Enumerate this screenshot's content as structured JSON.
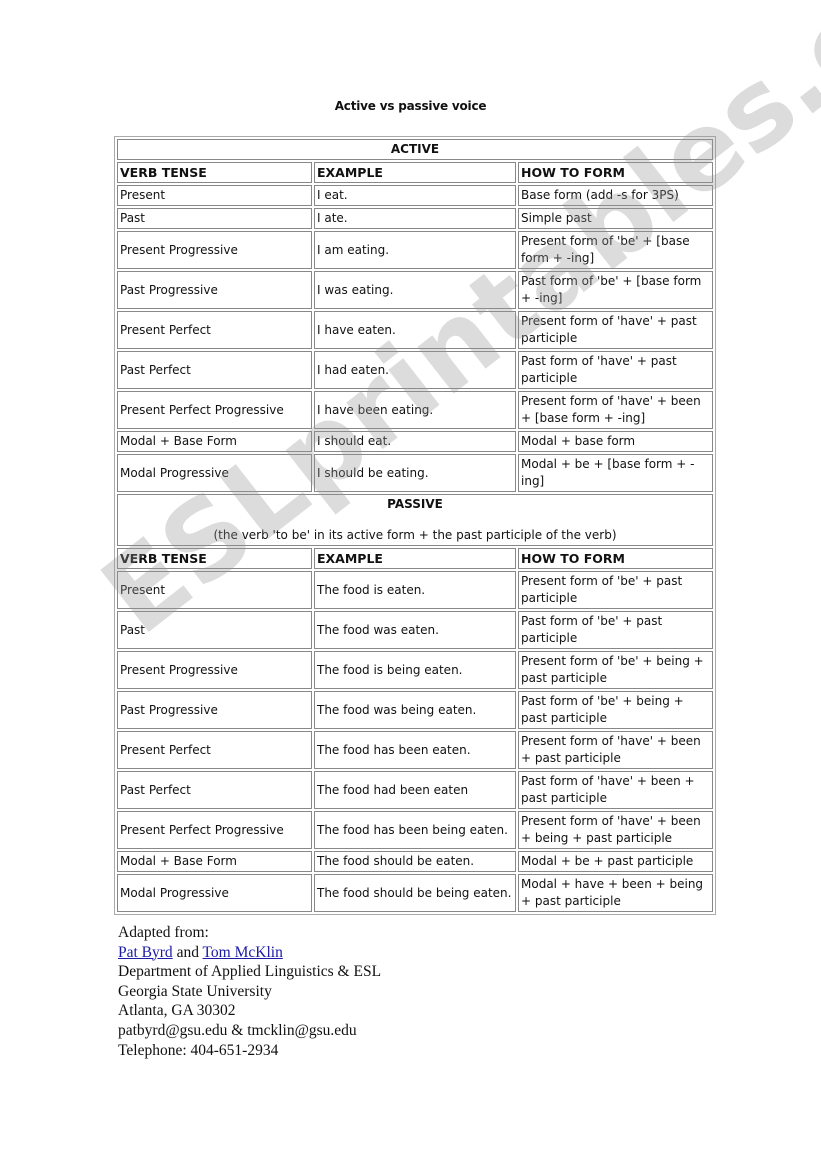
{
  "title": "Active vs passive voice",
  "headers": {
    "verb_tense": "VERB TENSE",
    "example": "EXAMPLE",
    "how_to_form": "HOW TO FORM"
  },
  "active": {
    "label": "ACTIVE",
    "rows": [
      [
        "Present",
        "I eat.",
        "Base form (add -s for 3PS)"
      ],
      [
        "Past",
        "I ate.",
        "Simple past"
      ],
      [
        "Present Progressive",
        "I am eating.",
        "Present form of 'be' + [base form + -ing]"
      ],
      [
        "Past Progressive",
        "I was eating.",
        "Past form of 'be' + [base form + -ing]"
      ],
      [
        "Present Perfect",
        "I have eaten.",
        "Present form of 'have' + past participle"
      ],
      [
        "Past Perfect",
        "I had eaten.",
        "Past form of 'have' + past participle"
      ],
      [
        "Present Perfect Progressive",
        "I have been eating.",
        "Present form of 'have' + been + [base form + -ing]"
      ],
      [
        "Modal + Base Form",
        "I should eat.",
        "Modal + base form"
      ],
      [
        "Modal Progressive",
        "I should be eating.",
        "Modal + be + [base form + -ing]"
      ]
    ]
  },
  "passive": {
    "label": "PASSIVE",
    "note": "(the verb 'to be' in its active form + the past participle of the verb)",
    "rows": [
      [
        "Present",
        "The food is eaten.",
        "Present form of 'be' + past participle"
      ],
      [
        "Past",
        "The food was eaten.",
        "Past form of 'be' + past participle"
      ],
      [
        "Present Progressive",
        "The food is being eaten.",
        "Present form of 'be' + being + past participle"
      ],
      [
        "Past Progressive",
        "The food was being eaten.",
        "Past form of 'be' + being + past participle"
      ],
      [
        "Present Perfect",
        "The food has been eaten.",
        "Present form of 'have' + been + past participle"
      ],
      [
        "Past Perfect",
        "The food had been eaten",
        "Past form of 'have' + been + past participle"
      ],
      [
        "Present Perfect Progressive",
        "The food has been being eaten.",
        "Present form of 'have' + been + being + past participle"
      ],
      [
        "Modal + Base Form",
        "The food should be eaten.",
        "Modal + be + past participle"
      ],
      [
        "Modal Progressive",
        "The food should be being eaten.",
        "Modal + have + been + being + past participle"
      ]
    ]
  },
  "credits": {
    "adapted_from": "Adapted from:",
    "author1": "Pat Byrd",
    "and": " and ",
    "author2": "Tom McKlin",
    "department": "Department of Applied Linguistics & ESL",
    "university": "Georgia State University",
    "address": "Atlanta, GA 30302",
    "emails": "patbyrd@gsu.edu & tmcklin@gsu.edu",
    "telephone": "Telephone: 404-651-2934"
  },
  "watermark": "ESLprintables.com"
}
